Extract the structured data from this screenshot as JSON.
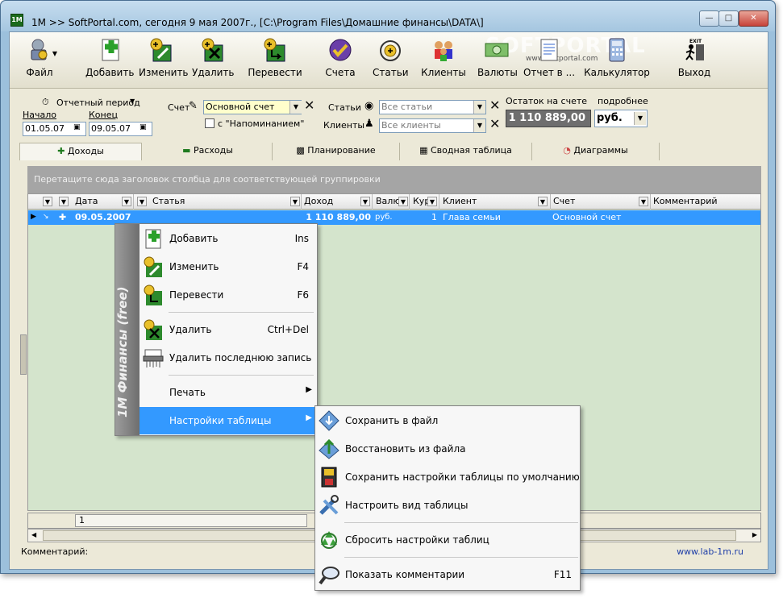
{
  "window": {
    "title": "1М >> SoftPortal.com, сегодня 9 мая 2007г., [C:\\Program Files\\Домашние финансы\\DATA\\]"
  },
  "watermark": {
    "text": "SOFTPORTAL",
    "url": "www.softportal.com"
  },
  "toolbar": {
    "file": "Файл",
    "add": "Добавить",
    "edit": "Изменить",
    "delete": "Удалить",
    "transfer": "Перевести",
    "accounts": "Счета",
    "articles": "Статьи",
    "clients": "Клиенты",
    "currencies": "Валюты",
    "report": "Отчет в ...",
    "calculator": "Калькулятор",
    "exit": "Выход"
  },
  "filters": {
    "period_label": "Отчетный период",
    "start_label": "Начало",
    "start_value": "01.05.07",
    "end_label": "Конец",
    "end_value": "09.05.07",
    "account_label": "Счет",
    "account_value": "Основной счет",
    "reminder_label": "с \"Напоминанием\"",
    "articles_label": "Статьи",
    "articles_value": "Все статьи",
    "clients_label": "Клиенты",
    "clients_value": "Все клиенты",
    "balance_label": "Остаток на счете",
    "details_label": "подробнее",
    "balance_value": "1 110 889,00",
    "currency_value": "руб."
  },
  "tabs": [
    "Доходы",
    "Расходы",
    "Планирование",
    "Сводная таблица",
    "Диаграммы"
  ],
  "grid": {
    "group_hint": "Перетащите сюда заголовок столбца для соответствующей группировки",
    "columns": [
      "Дата",
      "Статья",
      "Доход",
      "Валю",
      "Кур",
      "Клиент",
      "Счет",
      "Комментарий"
    ],
    "row": {
      "date": "09.05.2007",
      "income": "1 110 889,00",
      "currency": "руб.",
      "rate": "1",
      "client": "Глава семьи",
      "account": "Основной счет"
    },
    "footer_count": "1"
  },
  "status": {
    "comment_label": "Комментарий:",
    "url": "www.lab-1m.ru"
  },
  "context_menu": {
    "strip_text": "1М Финансы (free)",
    "items": [
      {
        "label": "Добавить",
        "shortcut": "Ins"
      },
      {
        "label": "Изменить",
        "shortcut": "F4"
      },
      {
        "label": "Перевести",
        "shortcut": "F6"
      },
      {
        "label": "Удалить",
        "shortcut": "Ctrl+Del"
      },
      {
        "label": "Удалить последнюю запись",
        "shortcut": ""
      },
      {
        "label": "Печать",
        "shortcut": ""
      },
      {
        "label": "Настройки таблицы",
        "shortcut": ""
      }
    ]
  },
  "submenu": {
    "items": [
      {
        "label": "Сохранить в файл",
        "shortcut": ""
      },
      {
        "label": "Восстановить из файла",
        "shortcut": ""
      },
      {
        "label": "Сохранить настройки таблицы по умолчанию",
        "shortcut": ""
      },
      {
        "label": "Настроить вид таблицы",
        "shortcut": ""
      },
      {
        "label": "Сбросить настройки таблиц",
        "shortcut": ""
      },
      {
        "label": "Показать комментарии",
        "shortcut": "F11"
      }
    ]
  },
  "colors": {
    "selection": "#3399ff",
    "grid_bg": "#d4e4cc",
    "group_bar": "#a5a5a5"
  }
}
